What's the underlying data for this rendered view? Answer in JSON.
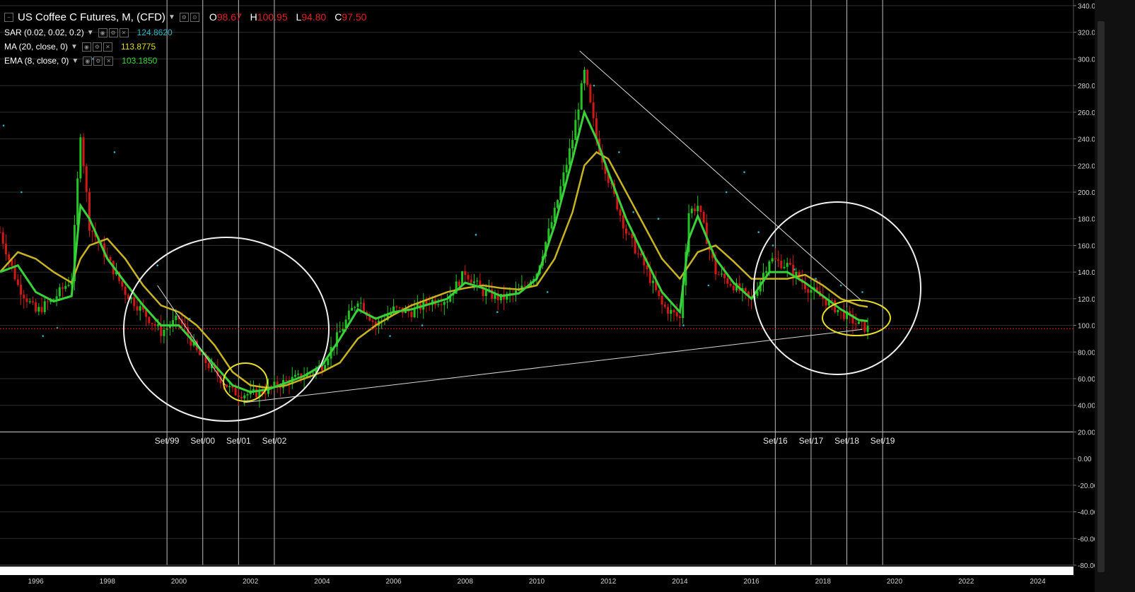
{
  "header": {
    "symbol": "US Coffee C Futures, M, (CFD)",
    "ohlc": [
      {
        "k": "O",
        "v": "98.67"
      },
      {
        "k": "H",
        "v": "100.95"
      },
      {
        "k": "L",
        "v": "94.80"
      },
      {
        "k": "C",
        "v": "97.50"
      }
    ]
  },
  "indicators": [
    {
      "label": "SAR (0.02, 0.02, 0.2)",
      "value": "124.8620",
      "color": "#2bb6c8"
    },
    {
      "label": "MA (20, close, 0)",
      "value": "113.8775",
      "color": "#d6d21a"
    },
    {
      "label": "EMA (8, close, 0)",
      "value": "103.1850",
      "color": "#3ad23a"
    }
  ],
  "price_label": "97.50",
  "vline_labels": [
    "Set/99",
    "Set/00",
    "Set/01",
    "Set/02",
    "Set/16",
    "Set/17",
    "Set/18",
    "Set/19"
  ],
  "vline_dates": [
    "1999-09-01",
    "2000-09-01",
    "2001-09-03",
    "2002-09-02",
    "2016-09-01",
    "2017-09-01",
    "2018-09-03",
    "2019-09-02"
  ],
  "chart_data": {
    "type": "candlestick",
    "title": "US Coffee C Futures, M, (CFD)",
    "x_ticks": [
      "1996",
      "1998",
      "2000",
      "2002",
      "2004",
      "2006",
      "2008",
      "2010",
      "2012",
      "2014",
      "2016",
      "2018",
      "2020",
      "2022",
      "2024"
    ],
    "y_ticks": [
      "340.00",
      "320.00",
      "300.00",
      "280.00",
      "260.00",
      "240.00",
      "220.00",
      "200.00",
      "180.00",
      "160.00",
      "140.00",
      "120.00",
      "100.00",
      "80.00",
      "60.00",
      "40.00",
      "20.00",
      "0.00",
      "-20.00",
      "-40.00",
      "-60.00",
      "-80.00"
    ],
    "ylim": [
      -80,
      340
    ],
    "xlim": [
      1995.0,
      2025.0
    ],
    "last_close": 97.5,
    "x": [
      1995.0,
      1995.5,
      1996.0,
      1996.5,
      1997.0,
      1997.25,
      1997.5,
      1998.0,
      1998.5,
      1999.0,
      1999.5,
      2000.0,
      2000.5,
      2001.0,
      2001.5,
      2002.0,
      2002.5,
      2003.0,
      2003.5,
      2004.0,
      2004.5,
      2005.0,
      2005.5,
      2006.0,
      2006.5,
      2007.0,
      2007.5,
      2008.0,
      2008.5,
      2009.0,
      2009.5,
      2010.0,
      2010.5,
      2011.0,
      2011.33,
      2011.67,
      2012.0,
      2012.5,
      2013.0,
      2013.5,
      2014.0,
      2014.25,
      2014.5,
      2015.0,
      2015.5,
      2016.0,
      2016.5,
      2017.0,
      2017.5,
      2018.0,
      2018.5,
      2019.0,
      2019.25
    ],
    "close": [
      170,
      130,
      110,
      120,
      135,
      245,
      175,
      150,
      125,
      110,
      95,
      105,
      80,
      65,
      50,
      48,
      52,
      58,
      62,
      70,
      95,
      120,
      100,
      112,
      110,
      118,
      120,
      140,
      125,
      120,
      125,
      140,
      185,
      240,
      290,
      240,
      210,
      170,
      145,
      115,
      105,
      185,
      190,
      140,
      130,
      118,
      150,
      145,
      130,
      120,
      110,
      100,
      97.5
    ],
    "ema": [
      140,
      145,
      125,
      118,
      122,
      190,
      180,
      150,
      132,
      115,
      100,
      100,
      85,
      70,
      55,
      50,
      52,
      57,
      62,
      70,
      90,
      112,
      105,
      110,
      112,
      116,
      120,
      132,
      128,
      122,
      124,
      135,
      175,
      225,
      260,
      240,
      215,
      180,
      152,
      125,
      110,
      165,
      182,
      150,
      132,
      120,
      140,
      140,
      132,
      122,
      112,
      104,
      103.2
    ],
    "ma": [
      140,
      155,
      150,
      140,
      132,
      150,
      160,
      165,
      150,
      130,
      115,
      110,
      100,
      85,
      65,
      55,
      53,
      55,
      60,
      65,
      72,
      90,
      100,
      108,
      115,
      120,
      125,
      128,
      130,
      128,
      127,
      130,
      150,
      185,
      220,
      230,
      225,
      200,
      175,
      150,
      135,
      145,
      155,
      160,
      148,
      135,
      135,
      135,
      138,
      130,
      120,
      115,
      113.9
    ],
    "sar": [
      [
        1995.1,
        250
      ],
      [
        1995.6,
        200
      ],
      [
        1996.2,
        92
      ],
      [
        1996.6,
        98
      ],
      [
        1997.6,
        300
      ],
      [
        1998.2,
        230
      ],
      [
        1999.4,
        145
      ],
      [
        2000.3,
        105
      ],
      [
        2003.9,
        68
      ],
      [
        2005.9,
        92
      ],
      [
        2006.8,
        100
      ],
      [
        2008.3,
        168
      ],
      [
        2008.9,
        110
      ],
      [
        2010.3,
        125
      ],
      [
        2011.6,
        280
      ],
      [
        2012.3,
        230
      ],
      [
        2012.7,
        185
      ],
      [
        2013.4,
        180
      ],
      [
        2014.1,
        100
      ],
      [
        2014.8,
        130
      ],
      [
        2015.3,
        200
      ],
      [
        2015.8,
        215
      ],
      [
        2016.2,
        170
      ],
      [
        2016.6,
        160
      ],
      [
        2017.2,
        142
      ],
      [
        2017.8,
        135
      ],
      [
        2018.5,
        130
      ],
      [
        2019.1,
        125
      ]
    ],
    "annotations": [
      "Set/99",
      "Set/00",
      "Set/01",
      "Set/02",
      "Set/16",
      "Set/17",
      "Set/18",
      "Set/19"
    ]
  },
  "colors": {
    "bull": "#22c322",
    "bear": "#d01818",
    "ema": "#3ad23a",
    "ma": "#c8b422",
    "sar": "#2bb6c8",
    "price_line": "#d01818",
    "grid": "#2e2e2e"
  }
}
